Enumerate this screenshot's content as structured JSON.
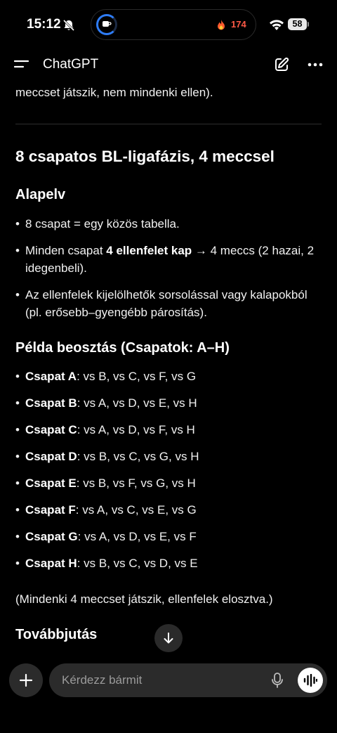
{
  "status_bar": {
    "time": "15:12",
    "fire_count": "174",
    "battery": "58"
  },
  "header": {
    "title": "ChatGPT"
  },
  "chat": {
    "prev_line": "meccset játszik, nem mindenki ellen).",
    "heading": "8 csapatos BL-ligafázis, 4 meccsel",
    "principle_title": "Alapelv",
    "principle_items": [
      {
        "pre": "8 csapat = egy közös tabella.",
        "bold": "",
        "post": ""
      },
      {
        "pre": "Minden csapat ",
        "bold": "4 ellenfelet kap",
        "post": " → 4 meccs (2 hazai, 2 idegenbeli)."
      },
      {
        "pre": "Az ellenfelek kijelölhetők sorsolással vagy kalapokból (pl. erősebb–gyengébb párosítás).",
        "bold": "",
        "post": ""
      }
    ],
    "example_title": "Példa beosztás (Csapatok: A–H)",
    "teams": [
      {
        "name": "Csapat A",
        "opponents": ": vs B, vs C, vs F, vs G"
      },
      {
        "name": "Csapat B",
        "opponents": ": vs A, vs D, vs E, vs H"
      },
      {
        "name": "Csapat C",
        "opponents": ": vs A, vs D, vs F, vs H"
      },
      {
        "name": "Csapat D",
        "opponents": ": vs B, vs C, vs G, vs H"
      },
      {
        "name": "Csapat E",
        "opponents": ": vs B, vs F, vs G, vs H"
      },
      {
        "name": "Csapat F",
        "opponents": ": vs A, vs C, vs E, vs G"
      },
      {
        "name": "Csapat G",
        "opponents": ": vs A, vs D, vs E, vs F"
      },
      {
        "name": "Csapat H",
        "opponents": ": vs B, vs C, vs D, vs E"
      }
    ],
    "note": "(Mindenki 4 meccset játszik, ellenfelek elosztva.)",
    "next_title": "Továbbjutás"
  },
  "composer": {
    "placeholder": "Kérdezz bármit"
  },
  "colors": {
    "background": "#000000",
    "bubble": "#2b2b2b",
    "accent_ring": "#2e7cf6",
    "fire": "#ff5a47"
  }
}
